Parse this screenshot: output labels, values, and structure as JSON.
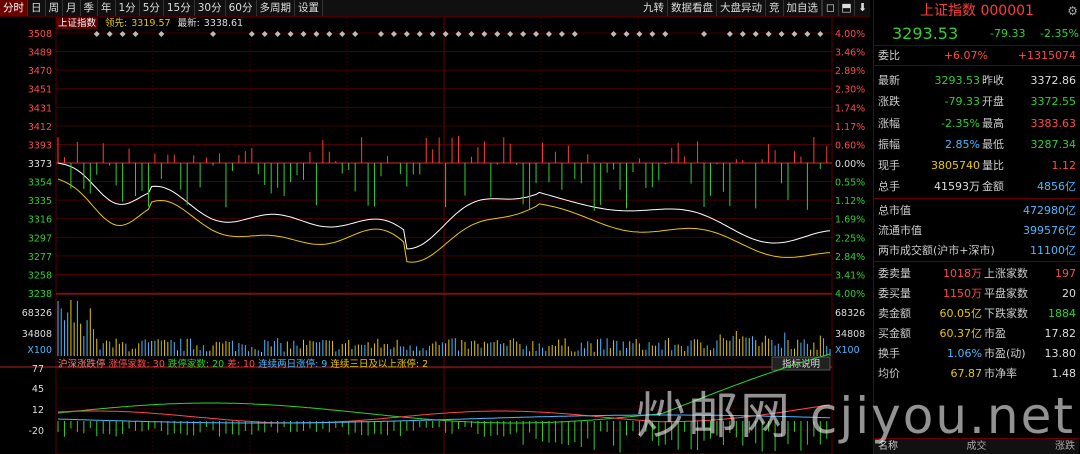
{
  "toolbar": {
    "tabs": [
      "分时",
      "日",
      "周",
      "月",
      "季",
      "年",
      "1分",
      "5分",
      "15分",
      "30分",
      "60分",
      "多周期",
      "设置"
    ],
    "active_tab": 0,
    "right_buttons": [
      "九转",
      "数据看盘",
      "大盘异动",
      "竞",
      "加自选"
    ],
    "icons": [
      "◻",
      "⬒",
      "⬇"
    ]
  },
  "info": {
    "name": "上证指数",
    "lead_label": "领先:",
    "lead_value": "3319.57",
    "latest_label": "最新:",
    "latest_value": "3338.61"
  },
  "axes": {
    "left_prices": [
      "3508",
      "3489",
      "3470",
      "3451",
      "3431",
      "3412",
      "3393",
      "3373",
      "3354",
      "3335",
      "3316",
      "3297",
      "3277",
      "3258",
      "3238"
    ],
    "right_pcts": [
      "4.00%",
      "3.46%",
      "2.89%",
      "2.30%",
      "1.74%",
      "1.17%",
      "0.60%",
      "0.00%",
      "0.55%",
      "1.12%",
      "1.69%",
      "2.25%",
      "2.84%",
      "3.41%",
      "4.00%"
    ],
    "vol_left": [
      "68326",
      "34808",
      "X100"
    ],
    "vol_right": [
      "68326",
      "34808",
      "X100"
    ],
    "bottom_left": [
      "77",
      "45",
      "12",
      "-20"
    ]
  },
  "breadth_bar": {
    "label": "沪深涨跌停",
    "limit_up_label": "涨停家数:",
    "limit_up_value": "30",
    "limit_down_label": "跌停家数:",
    "limit_down_value": "20",
    "diff_label": "差:",
    "diff_value": "10",
    "two_day_label": "连续两日涨停:",
    "two_day_value": "9",
    "three_day_label": "连续三日及以上涨停:",
    "three_day_value": "2",
    "indicator_btn": "指标说明"
  },
  "quote": {
    "title": "上证指数 000001",
    "price": "3293.53",
    "change": "-79.33",
    "change_pct": "-2.35%",
    "weibi_label": "委比",
    "weibi_pct": "+6.07%",
    "weibi_val": "+1315074",
    "rows": [
      {
        "l": "最新",
        "v": "3293.53",
        "vc": "green",
        "l2": "昨收",
        "v2": "3372.86",
        "v2c": "white"
      },
      {
        "l": "涨跌",
        "v": "-79.33",
        "vc": "green",
        "l2": "开盘",
        "v2": "3372.55",
        "v2c": "green"
      },
      {
        "l": "涨幅",
        "v": "-2.35%",
        "vc": "green",
        "l2": "最高",
        "v2": "3383.63",
        "v2c": "red"
      },
      {
        "l": "振幅",
        "v": "2.85%",
        "vc": "blue",
        "l2": "最低",
        "v2": "3287.34",
        "v2c": "green"
      },
      {
        "l": "现手",
        "v": "3805740",
        "vc": "yellow",
        "l2": "量比",
        "v2": "1.12",
        "v2c": "red"
      },
      {
        "l": "总手",
        "v": "41593万",
        "vc": "white",
        "l2": "金额",
        "v2": "4856亿",
        "v2c": "blue"
      }
    ],
    "mkt": [
      {
        "l": "总市值",
        "v": "472980亿"
      },
      {
        "l": "流通市值",
        "v": "399576亿"
      },
      {
        "l": "两市成交额(沪市+深市)",
        "v": "11100亿"
      }
    ],
    "stats": [
      {
        "l": "委卖量",
        "v": "1018万",
        "vc": "red",
        "l2": "上涨家数",
        "v2": "197",
        "v2c": "red"
      },
      {
        "l": "委买量",
        "v": "1150万",
        "vc": "red",
        "l2": "平盘家数",
        "v2": "20",
        "v2c": "white"
      },
      {
        "l": "卖金额",
        "v": "60.05亿",
        "vc": "yellow",
        "l2": "下跌家数",
        "v2": "1884",
        "v2c": "green"
      },
      {
        "l": "买金额",
        "v": "60.37亿",
        "vc": "yellow",
        "l2": "市盈",
        "v2": "17.82",
        "v2c": "white"
      },
      {
        "l": "换手",
        "v": "1.06%",
        "vc": "blue",
        "l2": "市盈(动)",
        "v2": "13.80",
        "v2c": "white"
      },
      {
        "l": "均价",
        "v": "67.87",
        "vc": "yellow",
        "l2": "市净率",
        "v2": "1.48",
        "v2c": "white"
      }
    ],
    "bottom": [
      "名称",
      "成交",
      "涨跌"
    ]
  },
  "watermark": "炒邮网 cjiyou.net",
  "colors": {
    "up": "#ff3c3c",
    "down": "#2ed12e",
    "avg": "#e6c800",
    "price": "#ffffff",
    "grid": "#5a0000"
  }
}
